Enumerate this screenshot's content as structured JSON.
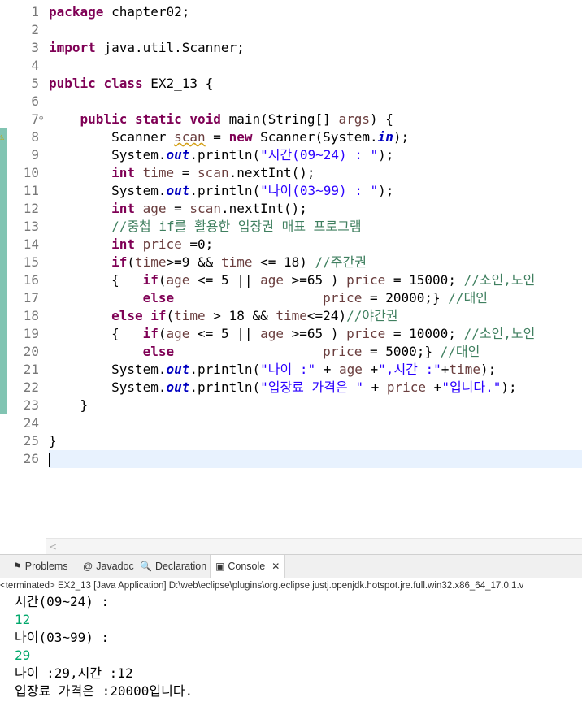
{
  "editor": {
    "lines": [
      {
        "n": "1",
        "html": "<span class=\"kw\">package</span> chapter02;"
      },
      {
        "n": "2",
        "html": ""
      },
      {
        "n": "3",
        "html": "<span class=\"kw\">import</span> java.util.Scanner;"
      },
      {
        "n": "4",
        "html": ""
      },
      {
        "n": "5",
        "html": "<span class=\"kw\">public</span> <span class=\"kw\">class</span> EX2_13 {"
      },
      {
        "n": "6",
        "html": ""
      },
      {
        "n": "7",
        "html": "    <span class=\"kw\">public</span> <span class=\"kw\">static</span> <span class=\"kw\">void</span> main(String[] <span class=\"var\">args</span>) {"
      },
      {
        "n": "8",
        "html": "        Scanner <span class=\"var squig\">scan</span> = <span class=\"kw\">new</span> Scanner(System.<span class=\"fld\">in</span>);"
      },
      {
        "n": "9",
        "html": "        System.<span class=\"fld\">out</span>.println(<span class=\"str\">\"시간(09~24) : \"</span>);"
      },
      {
        "n": "10",
        "html": "        <span class=\"kw\">int</span> <span class=\"var\">time</span> = <span class=\"var\">scan</span>.nextInt();"
      },
      {
        "n": "11",
        "html": "        System.<span class=\"fld\">out</span>.println(<span class=\"str\">\"나이(03~99) : \"</span>);"
      },
      {
        "n": "12",
        "html": "        <span class=\"kw\">int</span> <span class=\"var\">age</span> = <span class=\"var\">scan</span>.nextInt();"
      },
      {
        "n": "13",
        "html": "        <span class=\"cm\">//중첩 if를 활용한 입장권 매표 프로그램</span>"
      },
      {
        "n": "14",
        "html": "        <span class=\"kw\">int</span> <span class=\"var\">price</span> =0;"
      },
      {
        "n": "15",
        "html": "        <span class=\"kw\">if</span>(<span class=\"var\">time</span>>=9 &amp;&amp; <span class=\"var\">time</span> &lt;= 18) <span class=\"cm\">//주간권</span>"
      },
      {
        "n": "16",
        "html": "        {   <span class=\"kw\">if</span>(<span class=\"var\">age</span> &lt;= 5 || <span class=\"var\">age</span> >=65 ) <span class=\"var\">price</span> = 15000; <span class=\"cm\">//소인,노인</span>"
      },
      {
        "n": "17",
        "html": "            <span class=\"kw\">else</span>                   <span class=\"var\">price</span> = 20000;} <span class=\"cm\">//대인</span>"
      },
      {
        "n": "18",
        "html": "        <span class=\"kw\">else</span> <span class=\"kw\">if</span>(<span class=\"var\">time</span> > 18 &amp;&amp; <span class=\"var\">time</span>&lt;=24)<span class=\"cm\">//야간권</span>"
      },
      {
        "n": "19",
        "html": "        {   <span class=\"kw\">if</span>(<span class=\"var\">age</span> &lt;= 5 || <span class=\"var\">age</span> >=65 ) <span class=\"var\">price</span> = 10000; <span class=\"cm\">//소인,노인</span>"
      },
      {
        "n": "20",
        "html": "            <span class=\"kw\">else</span>                   <span class=\"var\">price</span> = 5000;} <span class=\"cm\">//대인</span>"
      },
      {
        "n": "21",
        "html": "        System.<span class=\"fld\">out</span>.println(<span class=\"str\">\"나이 :\"</span> + <span class=\"var\">age</span> +<span class=\"str\">\",시간 :\"</span>+<span class=\"var\">time</span>);"
      },
      {
        "n": "22",
        "html": "        System.<span class=\"fld\">out</span>.println(<span class=\"str\">\"입장료 가격은 \"</span> + <span class=\"var\">price</span> +<span class=\"str\">\"입니다.\"</span>);"
      },
      {
        "n": "23",
        "html": "    }"
      },
      {
        "n": "24",
        "html": ""
      },
      {
        "n": "25",
        "html": "}"
      },
      {
        "n": "26",
        "html": ""
      }
    ],
    "changed_lines": [
      "8",
      "9",
      "10",
      "11",
      "12",
      "13",
      "14",
      "15",
      "16",
      "17",
      "18",
      "19",
      "20",
      "21",
      "22",
      "23"
    ],
    "warning_line": "8",
    "fold_line": "7",
    "current_line": "26",
    "fold_icon": "⊖",
    "warning_icon": "⚠"
  },
  "scroll": {
    "arrow": "<"
  },
  "console": {
    "tabs": [
      {
        "name": "tab-problems",
        "icon": "⚑",
        "icon_name": "problems-icon",
        "label": "Problems"
      },
      {
        "name": "tab-javadoc",
        "icon": "@",
        "icon_name": "javadoc-icon",
        "label": "Javadoc"
      },
      {
        "name": "tab-declaration",
        "icon": "🔍",
        "icon_name": "declaration-icon",
        "label": "Declaration"
      },
      {
        "name": "tab-console",
        "icon": "▣",
        "icon_name": "console-icon",
        "label": "Console",
        "close": "✕"
      }
    ],
    "status": "<terminated> EX2_13 [Java Application] D:\\web\\eclipse\\plugins\\org.eclipse.justj.openjdk.hotspot.jre.full.win32.x86_64_17.0.1.v",
    "output": [
      {
        "text": "시간(09~24) :",
        "kind": "out"
      },
      {
        "text": "12",
        "kind": "in"
      },
      {
        "text": "나이(03~99) :",
        "kind": "out"
      },
      {
        "text": "29",
        "kind": "in"
      },
      {
        "text": "나이 :29,시간 :12",
        "kind": "out"
      },
      {
        "text": "입장료 가격은 :20000입니다.",
        "kind": "out"
      }
    ],
    "input_color": "#00a86b"
  }
}
